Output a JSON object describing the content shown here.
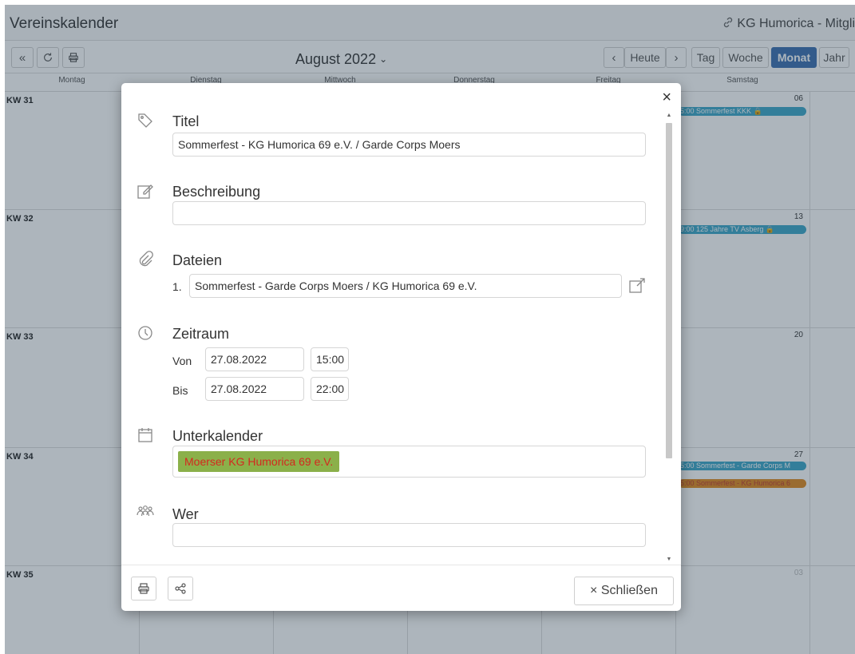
{
  "app": {
    "title": "Vereinskalender",
    "org_link": "KG Humorica - Mitgli"
  },
  "toolbar": {
    "month_label": "August 2022",
    "today_label": "Heute",
    "views": [
      "Tag",
      "Woche",
      "Monat",
      "Jahr"
    ],
    "active_view": "Monat",
    "accent_color": "#3a6fb0"
  },
  "calendar": {
    "weekdays": [
      "Montag",
      "Dienstag",
      "Mittwoch",
      "Donnerstag",
      "Freitag",
      "Samstag"
    ],
    "weeks": [
      {
        "kw": "KW 31",
        "sat_day": "06",
        "events": [
          {
            "label": "5:00 Sommerfest KKK",
            "color": "#3aa6c8",
            "locked": true
          }
        ]
      },
      {
        "kw": "KW 32",
        "sat_day": "13",
        "events": [
          {
            "label": "9:00 125 Jahre TV Asberg",
            "color": "#3aa6c8",
            "locked": true
          }
        ]
      },
      {
        "kw": "KW 33",
        "sat_day": "20",
        "events": []
      },
      {
        "kw": "KW 34",
        "sat_day": "27",
        "events": [
          {
            "label": "5:00 Sommerfest - Garde Corps M",
            "color": "#3aa6c8",
            "locked": false
          },
          {
            "label": "5:00 Sommerfest - KG Humorica 6",
            "color": "#e08a1e",
            "locked": false
          }
        ]
      },
      {
        "kw": "KW 35",
        "sat_day": "03",
        "events": []
      }
    ]
  },
  "modal": {
    "title_label": "Titel",
    "title_value": "Sommerfest - KG Humorica 69 e.V. / Garde Corps Moers",
    "description_label": "Beschreibung",
    "description_value": "",
    "files_label": "Dateien",
    "file_index": "1.",
    "file_name": "Sommerfest - Garde Corps Moers / KG Humorica 69 e.V.",
    "timeframe_label": "Zeitraum",
    "from_label": "Von",
    "from_date": "27.08.2022",
    "from_time": "15:00",
    "to_label": "Bis",
    "to_date": "27.08.2022",
    "to_time": "22:00",
    "subcalendar_label": "Unterkalender",
    "subcalendar_tag": "Moerser KG Humorica 69 e.V.",
    "who_label": "Wer",
    "who_value": "",
    "close_label": "× Schließen"
  }
}
